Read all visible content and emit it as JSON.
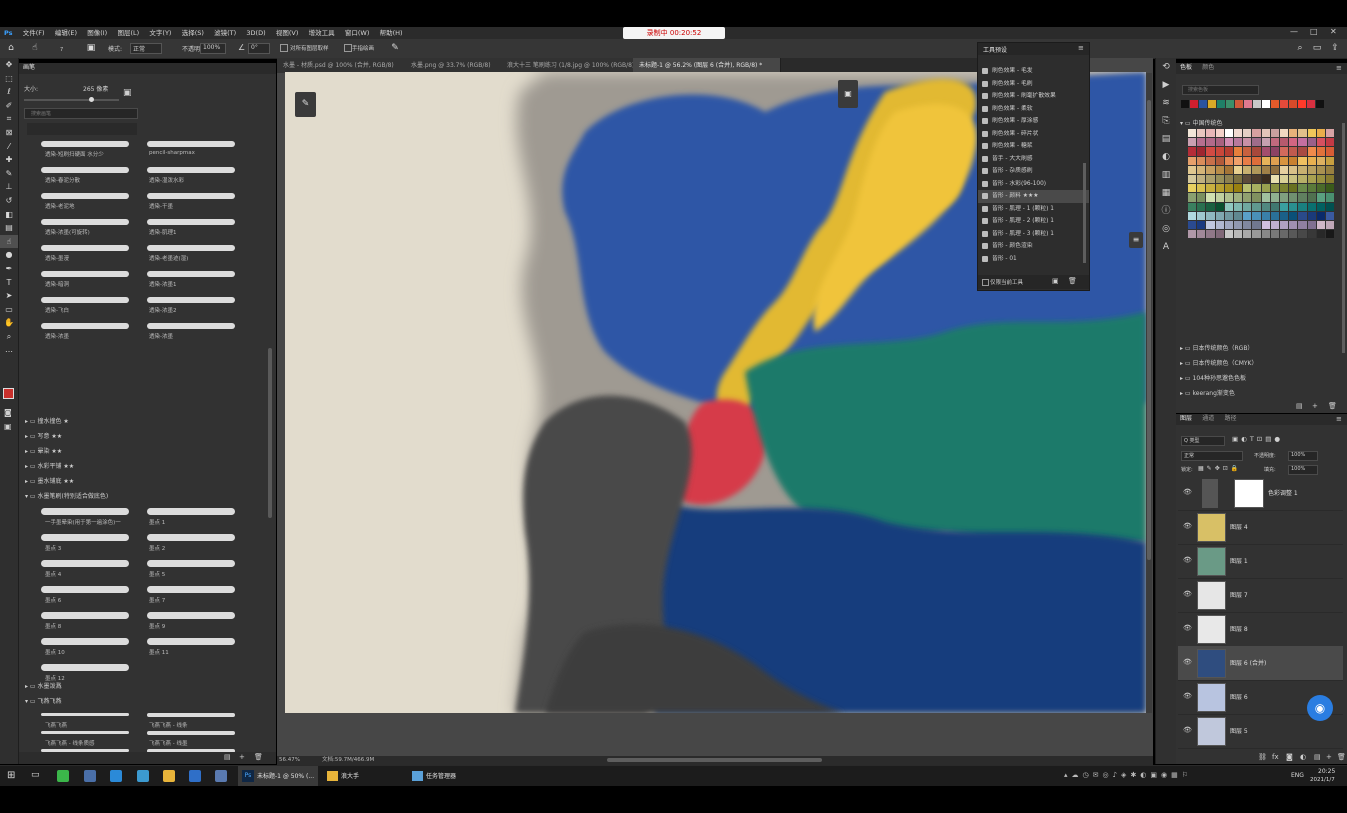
{
  "recording": {
    "text": "录制中 00:20:52"
  },
  "menu": {
    "items": [
      "文件(F)",
      "编辑(E)",
      "图像(I)",
      "图层(L)",
      "文字(Y)",
      "选择(S)",
      "滤镜(T)",
      "3D(D)",
      "视图(V)",
      "增效工具",
      "窗口(W)",
      "帮助(H)"
    ]
  },
  "options": {
    "mode_label": "模式:",
    "mode_value": "正常",
    "opacity_label": "不透明度:",
    "opacity_value": "100%",
    "flow_label": "流量:",
    "flow_value": "100%",
    "angle_value": "0°",
    "sample_all": "对所有图层取样",
    "auto_erase": "手指绘画",
    "size_value": "7"
  },
  "brushes": {
    "tab": "画笔",
    "size_label": "大小:",
    "size_value": "265 像素",
    "search_placeholder": "搜索画笔",
    "row_labels_left": [
      "透染-短刷扫硬面 水分少",
      "透染-春泥分散",
      "透染-老泥地",
      "透染-浓墨(可旋转)",
      "透染-墨漫",
      "透染-暗洞",
      "透染-飞白",
      "透染-浓墨"
    ],
    "row_labels_right": [
      "pencil-sharpmax",
      "透染-湿泼水彩",
      "透染-干墨",
      "透染-肌理1",
      "透染-老墨迹(湿)",
      "透染-浓墨1",
      "透染-浓墨2",
      "透染-浓墨"
    ],
    "folders": [
      "撞水撞色 ★",
      "写意 ★★",
      "晕染 ★★",
      "水彩平铺 ★★",
      "墨水铺底 ★★"
    ],
    "open_folder": "水墨笔刷(特别适合做底色)",
    "ink_left": [
      "一手墨晕染(用于第一遍涂色)一",
      "墨点 3",
      "墨点 4",
      "墨点 6",
      "墨点 8",
      "墨点 10",
      "墨点 12"
    ],
    "ink_right": [
      "墨点 1",
      "墨点 2",
      "墨点 5",
      "墨点 7",
      "墨点 9",
      "墨点 11"
    ],
    "folder2": "水墨泼溅",
    "folder3": "飞燕飞燕",
    "fly_left": [
      "飞燕飞燕",
      "飞燕飞燕 - 线条质感",
      "飞燕飞燕 - 行书法"
    ],
    "fly_right": [
      "飞燕飞燕 - 线条",
      "飞燕飞燕 - 线墨",
      "飞燕飞燕 - 线墨"
    ]
  },
  "tabs": [
    {
      "label": "水墨 - 材质.psd @ 100% (合并, RGB/8)",
      "active": false
    },
    {
      "label": "水墨.png @ 33.7% (RGB/8)",
      "active": false
    },
    {
      "label": "浪大十三 笔刷练习 (1/8.jpg @ 100% (RGB/8)",
      "active": false
    },
    {
      "label": "未标题-1 @ 56.2% (图层 6 (合并), RGB/8) *",
      "active": true
    }
  ],
  "status": {
    "zoom": "56.47%",
    "doc": "文档:59.7M/466.9M"
  },
  "toolpresets": {
    "title": "工具预设",
    "items": [
      "刷色效果 - 毛发",
      "刷色效果 - 毛刷",
      "刷色效果 - 刷毫扩散效果",
      "刷色效果 - 柔软",
      "刷色效果 - 厚涂感",
      "刷色效果 - 碎片状",
      "刷色效果 - 糖浆",
      "皆手 - 大大刷感",
      "皆形 - 杂质感刷",
      "皆形 - 水彩(96-100)",
      "皆形 - 颜料 ★★★",
      "皆形 - 肌理 - 1 (颗粒) 1",
      "皆形 - 肌理 - 2 (颗粒) 1",
      "皆形 - 肌理 - 3 (颗粒) 1",
      "皆形 - 颜色渲染",
      "皆形 - 01"
    ],
    "selected_index": 10,
    "footer": "仅限当前工具"
  },
  "swatches": {
    "tabs": [
      "色板",
      "颜色"
    ],
    "search_placeholder": "搜索色板",
    "folder_open": "中国传统色",
    "folders": [
      "日本传统颜色（RGB）",
      "日本传统颜色（CMYK）",
      "104种孙思邈色色板",
      "keerang渐变色"
    ],
    "top_colors": [
      "#111111",
      "#d11f2f",
      "#2a53a0",
      "#d9a927",
      "#1f7f67",
      "#3c8f6a",
      "#d05a3a",
      "#e07a90",
      "#c8c8c8",
      "#ffffff",
      "#e45a2a",
      "#e44a3a",
      "#d74a2a",
      "#ff3a2a",
      "#d63040",
      "#111111"
    ],
    "grid_colors": [
      "#f2e6d8",
      "#e8c7bf",
      "#e7b7b7",
      "#f2d0c8",
      "#ffffff",
      "#f0d9d0",
      "#e4cfc5",
      "#d7a0a0",
      "#e2c5b9",
      "#c9a0a0",
      "#f1d8c1",
      "#e8b27a",
      "#e2c08a",
      "#f0c75a",
      "#e9ad4a",
      "#d7a3a5",
      "#caa0b2",
      "#b66f8f",
      "#b26a8a",
      "#a86180",
      "#d08bb2",
      "#b8799d",
      "#c891a6",
      "#9f6c8a",
      "#c6a0b0",
      "#c0697e",
      "#b65a6d",
      "#d36582",
      "#c46fa0",
      "#9a608a",
      "#d65060",
      "#c33a45",
      "#b52d38",
      "#9e2630",
      "#d24a43",
      "#c9473a",
      "#b63d30",
      "#e6803c",
      "#c7613f",
      "#a8483b",
      "#a34d6d",
      "#8c4264",
      "#d26a5c",
      "#c05a4e",
      "#a84a42",
      "#f08a4b",
      "#e2723b",
      "#d85d35",
      "#e6a06b",
      "#d98c5a",
      "#c8704a",
      "#b25a3a",
      "#e58a55",
      "#f0a06a",
      "#e87d48",
      "#de6d3a",
      "#e6b25a",
      "#e0a050",
      "#d89440",
      "#c88030",
      "#f0c060",
      "#e8b050",
      "#ddb060",
      "#c8a040",
      "#e0c890",
      "#d4b478",
      "#c8a060",
      "#b88c48",
      "#a47436",
      "#e8d090",
      "#c8b070",
      "#b0985a",
      "#a08048",
      "#907040",
      "#e6d0a0",
      "#d8c088",
      "#c8b070",
      "#b8a060",
      "#a89050",
      "#988040",
      "#d4c89c",
      "#c0b080",
      "#aca06c",
      "#98905a",
      "#8c8050",
      "#7c7040",
      "#5b4a3a",
      "#4a3a2c",
      "#3a2c20",
      "#e8e0b0",
      "#d8d098",
      "#c8c080",
      "#b8b068",
      "#a8a050",
      "#989040",
      "#887c30",
      "#e8d060",
      "#d8c050",
      "#c8b040",
      "#b8a030",
      "#a89020",
      "#988010",
      "#b8c070",
      "#a8b060",
      "#98a050",
      "#889040",
      "#788030",
      "#687020",
      "#6a8a4a",
      "#5a7a3a",
      "#4a6a2a",
      "#3a5a1a",
      "#8aa070",
      "#7a9060",
      "#d0e0b0",
      "#c0d0a0",
      "#b0c090",
      "#a0b080",
      "#90a070",
      "#809060",
      "#a0c0a0",
      "#90b090",
      "#80a080",
      "#709070",
      "#608060",
      "#507050",
      "#5aa080",
      "#4a9070",
      "#3a8060",
      "#2a7050",
      "#1a6040",
      "#0a5030",
      "#90c8c0",
      "#80b8b0",
      "#70a8a0",
      "#609890",
      "#508880",
      "#407870",
      "#3aa0a0",
      "#2a9090",
      "#1a8080",
      "#0a7070",
      "#006060",
      "#005050",
      "#b0d8e0",
      "#a0c8d0",
      "#90b8c0",
      "#80a8b0",
      "#7098a0",
      "#608890",
      "#5aa0c8",
      "#4a90b8",
      "#3a80a8",
      "#2a7098",
      "#1a6088",
      "#0a5078",
      "#2a4a8a",
      "#1a3a7a",
      "#0a2a6a",
      "#3a5aa0",
      "#2a4a90",
      "#1a3a80",
      "#c0c8e0",
      "#b0b8d0",
      "#a0a8c0",
      "#9098b0",
      "#8088a0",
      "#707890",
      "#d0c0e0",
      "#c0b0d0",
      "#b0a0c0",
      "#a090b0",
      "#9080a0",
      "#807090",
      "#d0b8c8",
      "#c0a8b8",
      "#b098a8",
      "#a08898",
      "#907888",
      "#806878",
      "#c8c8c8",
      "#b8b8b8",
      "#a8a8a8",
      "#989898",
      "#888888",
      "#787878",
      "#686868",
      "#585858",
      "#484848",
      "#383838",
      "#282828",
      "#181818"
    ]
  },
  "layers": {
    "tabs": [
      "图层",
      "通道",
      "路径"
    ],
    "kind": "Q 类型",
    "blend": "正常",
    "opacity_label": "不透明度:",
    "opacity_value": "100%",
    "lock_label": "锁定:",
    "fill_label": "填充:",
    "fill_value": "100%",
    "items": [
      {
        "name": "色彩调整 1",
        "selected": false
      },
      {
        "name": "图层 4",
        "selected": false
      },
      {
        "name": "图层 1",
        "selected": false
      },
      {
        "name": "图层 7",
        "selected": false
      },
      {
        "name": "图层 8",
        "selected": false
      },
      {
        "name": "图层 6 (合并)",
        "selected": true
      },
      {
        "name": "图层 6",
        "selected": false
      },
      {
        "name": "图层 5",
        "selected": false
      }
    ]
  },
  "taskbar": {
    "items": [
      {
        "label": "未标题-1 @ 50% (..."
      },
      {
        "label": "浪大手"
      },
      {
        "label": "任务管理器"
      }
    ],
    "time": "20:25",
    "date": "2021/1/7",
    "lang": "ENG"
  }
}
